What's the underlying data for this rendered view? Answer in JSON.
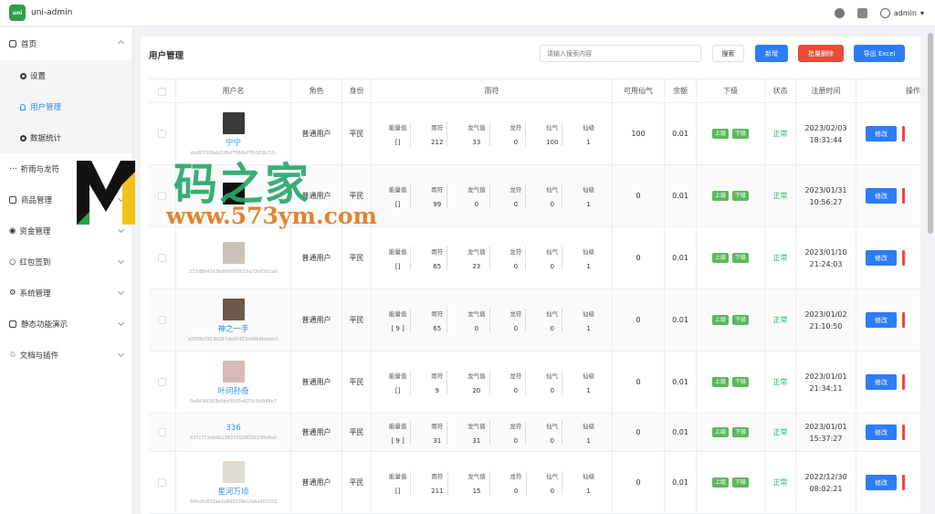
{
  "app": {
    "title": "uni-admin",
    "logo_text": "uni",
    "user": "admin"
  },
  "sidebar": {
    "items": [
      {
        "label": "首页",
        "expanded": true
      },
      {
        "label": "设置"
      },
      {
        "label": "用户管理",
        "active": true
      },
      {
        "label": "数据统计"
      },
      {
        "label": "祈雨与龙符"
      },
      {
        "label": "商品管理"
      },
      {
        "label": "资金管理"
      },
      {
        "label": "红包签到"
      },
      {
        "label": "系统管理"
      },
      {
        "label": "静态功能演示"
      },
      {
        "label": "文档与插件"
      }
    ]
  },
  "panel": {
    "title": "用户管理",
    "search_placeholder": "请输入搜索内容",
    "search_label": "搜索",
    "add_label": "新增",
    "batch_delete_label": "批量删除",
    "export_label": "导出 Excel"
  },
  "table": {
    "headers": {
      "username": "用户名",
      "role": "角色",
      "identity": "身份",
      "rain": "雨符",
      "xianqi": "可用仙气",
      "balance": "余额",
      "sub": "下级",
      "status": "状态",
      "reg": "注册时间",
      "op": "操作"
    },
    "rain_labels": [
      "能量值",
      "雨符",
      "龙气值",
      "龙符",
      "仙气",
      "仙级"
    ],
    "sub_tags": [
      "上级",
      "下级"
    ],
    "edit_label": "修改",
    "rows": [
      {
        "name": "宁宁",
        "uid": "dcd97f1f0abf1f8cf7966ef76cb58c72c",
        "role": "普通用户",
        "identity": "平民",
        "rain": [
          "[]",
          "212",
          "33",
          "0",
          "100",
          "1"
        ],
        "xianqi": "100",
        "balance": "0.01",
        "status": "正常",
        "date": "2023/02/03",
        "time": "18:31:44",
        "avatar": "#3a3a3a"
      },
      {
        "name": "",
        "uid": "",
        "role": "普通用户",
        "identity": "平民",
        "rain": [
          "[]",
          "99",
          "0",
          "0",
          "0",
          "1"
        ],
        "xianqi": "0",
        "balance": "0.01",
        "status": "正常",
        "date": "2023/01/31",
        "time": "10:56:27",
        "avatar": "#111111"
      },
      {
        "name": "",
        "uid": "272d8d4263bd6f3000023a73a65b1a8",
        "role": "普通用户",
        "identity": "平民",
        "rain": [
          "[]",
          "65",
          "23",
          "0",
          "0",
          "1"
        ],
        "xianqi": "0",
        "balance": "0.01",
        "status": "正常",
        "date": "2023/01/10",
        "time": "21:24:03",
        "avatar": "#c9c2b8"
      },
      {
        "name": "神之一手",
        "uid": "d26f8b7953b287da00483dd6b4bbdec1",
        "role": "普通用户",
        "identity": "平民",
        "rain": [
          "[ 9 ]",
          "65",
          "0",
          "0",
          "0",
          "1"
        ],
        "xianqi": "0",
        "balance": "0.01",
        "status": "正常",
        "date": "2023/01/02",
        "time": "21:10:50",
        "avatar": "#6b5a4a"
      },
      {
        "name": "叶问孙奇",
        "uid": "0a8436f163b9bd3003e825d1fc848e7",
        "role": "普通用户",
        "identity": "平民",
        "rain": [
          "[]",
          "9",
          "20",
          "0",
          "0",
          "1"
        ],
        "xianqi": "0",
        "balance": "0.01",
        "status": "正常",
        "date": "2023/01/01",
        "time": "21:34:11",
        "avatar": "#d8b9b9"
      },
      {
        "name": "336",
        "uid": "637c772e69b13637002802d1f90dfe0",
        "role": "普通用户",
        "identity": "平民",
        "rain": [
          "[ 9 ]",
          "31",
          "31",
          "0",
          "0",
          "1"
        ],
        "xianqi": "0",
        "balance": "0.01",
        "status": "正常",
        "date": "2023/01/01",
        "time": "15:37:27",
        "avatar": ""
      },
      {
        "name": "星河万顷",
        "uid": "36fcdfc603ae2a8d0039e1fa6ad07253",
        "role": "普通用户",
        "identity": "平民",
        "rain": [
          "[]",
          "211",
          "15",
          "0",
          "0",
          "1"
        ],
        "xianqi": "0",
        "balance": "0.01",
        "status": "正常",
        "date": "2022/12/30",
        "time": "08:02:21",
        "avatar": "#e2dcd6"
      }
    ]
  },
  "watermark": {
    "title": "码之家",
    "url": "www.573ym.com"
  },
  "colors": {
    "primary": "#2d7cf6",
    "danger": "#e84b3a",
    "success": "#19be6b",
    "tag": "#5cb85c",
    "watermark_green": "#2aa86a",
    "watermark_orange": "#e07a1f"
  }
}
